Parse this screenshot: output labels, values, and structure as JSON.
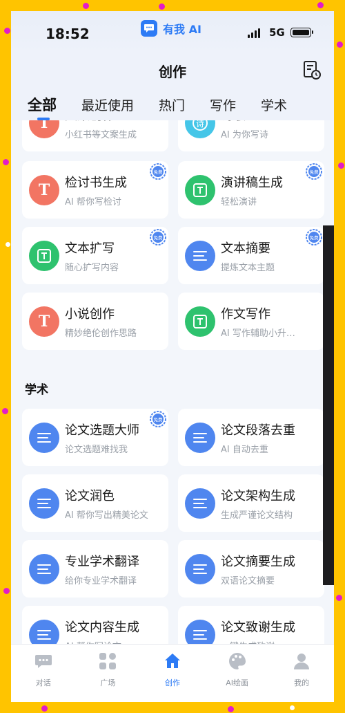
{
  "status": {
    "time": "18:52",
    "app_name": "有我 AI",
    "network": "5G"
  },
  "header": {
    "title": "创作"
  },
  "tabs": [
    "全部",
    "最近使用",
    "热门",
    "写作",
    "学术"
  ],
  "free_badge": "免费",
  "writing_partial": [
    {
      "title": "文案创作",
      "subtitle": "小红书等文案生成",
      "icon": "text-T-icon",
      "color": "#F27563"
    },
    {
      "title": "诗歌",
      "subtitle": "AI 为你写诗",
      "icon": "poem-icon",
      "color": "#45C6E8"
    }
  ],
  "writing": [
    {
      "title": "检讨书生成",
      "subtitle": "AI 帮你写检讨",
      "icon": "text-T-icon",
      "color": "#F27563",
      "free": true
    },
    {
      "title": "演讲稿生成",
      "subtitle": "轻松演讲",
      "icon": "text-box-icon",
      "color": "#2EC26E",
      "free": true
    },
    {
      "title": "文本扩写",
      "subtitle": "随心扩写内容",
      "icon": "text-box-icon",
      "color": "#2EC26E",
      "free": true
    },
    {
      "title": "文本摘要",
      "subtitle": "提炼文本主题",
      "icon": "lines-icon",
      "color": "#4F86EF",
      "free": true
    },
    {
      "title": "小说创作",
      "subtitle": "精妙绝伦创作思路",
      "icon": "text-T-icon",
      "color": "#F27563",
      "free": false
    },
    {
      "title": "作文写作",
      "subtitle": "AI 写作辅助小升…",
      "icon": "text-box-icon",
      "color": "#2EC26E",
      "free": false
    }
  ],
  "academic_section": "学术",
  "academic": [
    {
      "title": "论文选题大师",
      "subtitle": "论文选题难找我",
      "icon": "lines-icon",
      "color": "#4F86EF",
      "free": true
    },
    {
      "title": "论文段落去重",
      "subtitle": "AI 自动去重",
      "icon": "lines-icon",
      "color": "#4F86EF",
      "free": false
    },
    {
      "title": "论文润色",
      "subtitle": "AI 帮你写出精美论文",
      "icon": "lines-icon",
      "color": "#4F86EF",
      "free": false
    },
    {
      "title": "论文架构生成",
      "subtitle": "生成严谨论文结构",
      "icon": "lines-icon",
      "color": "#4F86EF",
      "free": false
    },
    {
      "title": "专业学术翻译",
      "subtitle": "给你专业学术翻译",
      "icon": "lines-icon",
      "color": "#4F86EF",
      "free": false
    },
    {
      "title": "论文摘要生成",
      "subtitle": "双语论文摘要",
      "icon": "lines-icon",
      "color": "#4F86EF",
      "free": false
    },
    {
      "title": "论文内容生成",
      "subtitle": "AI 帮你写论文",
      "icon": "lines-icon",
      "color": "#4F86EF",
      "free": false
    },
    {
      "title": "论文致谢生成",
      "subtitle": "一键生成致谢",
      "icon": "lines-icon",
      "color": "#4F86EF",
      "free": false
    }
  ],
  "bottom_nav": [
    {
      "label": "对话",
      "icon": "chat-icon",
      "active": false
    },
    {
      "label": "广场",
      "icon": "grid-icon",
      "active": false
    },
    {
      "label": "创作",
      "icon": "home-icon",
      "active": true
    },
    {
      "label": "AI绘画",
      "icon": "palette-icon",
      "active": false
    },
    {
      "label": "我的",
      "icon": "user-icon",
      "active": false
    }
  ],
  "colors": {
    "accent": "#2D7BF5",
    "frame": "#FFC400",
    "confetti": "#E31CC8"
  }
}
